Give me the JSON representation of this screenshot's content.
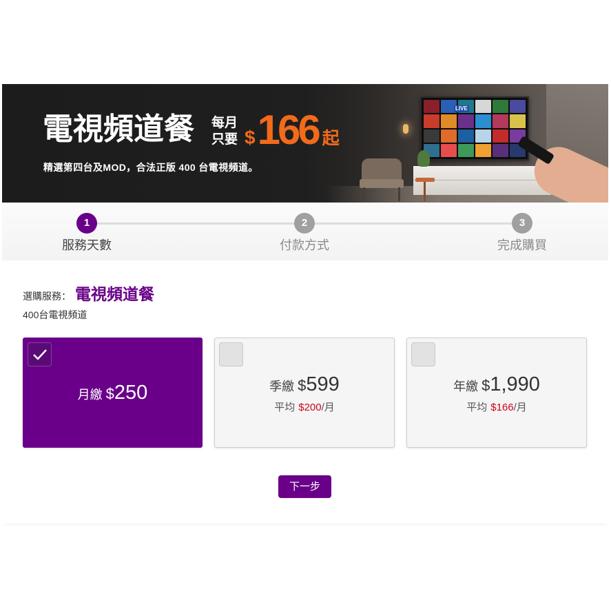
{
  "banner": {
    "title": "電視頻道餐",
    "price_prefix_line1": "每月",
    "price_prefix_line2": "只要",
    "price_currency": "$",
    "price_amount": "166",
    "price_suffix": "起",
    "subtitle": "精選第四台及MOD，合法正版 400 台電視頻道。",
    "tv_screen_label": "LIVE"
  },
  "stepper": {
    "steps": [
      {
        "number": "1",
        "label": "服務天數",
        "active": true
      },
      {
        "number": "2",
        "label": "付款方式",
        "active": false
      },
      {
        "number": "3",
        "label": "完成購買",
        "active": false
      }
    ]
  },
  "service": {
    "label": "選購服務：",
    "name": "電視頻道餐",
    "description": "400台電視頻道"
  },
  "plans": [
    {
      "period": "月繳",
      "currency": "$",
      "price": "250",
      "selected": true
    },
    {
      "period": "季繳",
      "currency": "$",
      "price": "599",
      "avg_label": "平均",
      "avg_price": "$200",
      "avg_unit": "/月",
      "selected": false
    },
    {
      "period": "年繳",
      "currency": "$",
      "price": "1,990",
      "avg_label": "平均",
      "avg_price": "$166",
      "avg_unit": "/月",
      "selected": false
    }
  ],
  "next_button": {
    "label": "下一步"
  },
  "icons": {
    "selected_check": "check-icon"
  },
  "colors": {
    "brand": "#6a0089",
    "accent_orange": "#f26a1b",
    "price_red": "#d0021b",
    "inactive_step": "#a0a0a0"
  }
}
